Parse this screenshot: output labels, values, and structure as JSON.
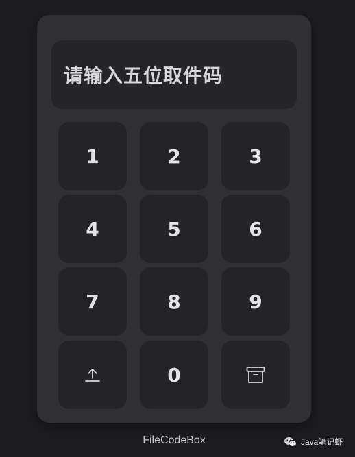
{
  "display": {
    "placeholder": "请输入五位取件码"
  },
  "keypad": {
    "digits": [
      "1",
      "2",
      "3",
      "4",
      "5",
      "6",
      "7",
      "8",
      "9",
      "0"
    ],
    "upload_icon": "upload-icon",
    "archive_icon": "archive-icon"
  },
  "footer": {
    "brand": "FileCodeBox"
  },
  "watermark": {
    "text": "Java笔记虾",
    "icon": "wechat-icon"
  },
  "colors": {
    "background": "#1c1b20",
    "card": "#303033",
    "key": "#242427",
    "text": "#e3e3e6"
  }
}
